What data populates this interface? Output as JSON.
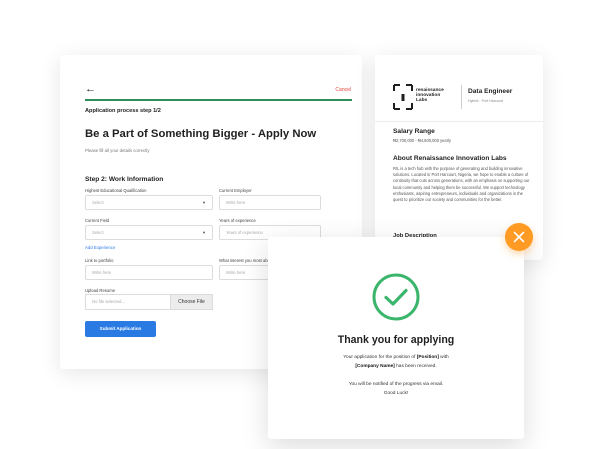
{
  "form": {
    "back_arrow": "←",
    "cancel": "Cancel",
    "step_label": "Application process step 1/2",
    "progress": 1.0,
    "title": "Be a Part of Something Bigger - Apply Now",
    "subtitle": "Please fill all your details correctly",
    "section": "Step 2: Work Information",
    "fields": {
      "qualification": {
        "label": "Highest Educational Qualification",
        "placeholder": "Select"
      },
      "employer": {
        "label": "Current Employer",
        "placeholder": "Write here"
      },
      "current_field": {
        "label": "Current Field",
        "placeholder": "Select"
      },
      "experience": {
        "label": "Years of experience",
        "placeholder": "Years of experience"
      },
      "portfolio": {
        "label": "Link to portfolio",
        "placeholder": "Write here"
      },
      "interest": {
        "label": "What interest you most abo",
        "placeholder": "Write here"
      }
    },
    "add_experience": "Add Experience",
    "upload_label": "Upload Resume",
    "file_placeholder": "No file selected...",
    "choose_file": "Choose File",
    "submit": "Submit Application"
  },
  "job": {
    "logo_lines": [
      "renaissance",
      "innovation",
      "Labs"
    ],
    "title": "Data Engineer",
    "meta": "Hybrid · Port Harcourt",
    "salary_heading": "Salary Range",
    "salary_value": "₦2,700,000 - ₦4,500,000 yearly",
    "about_heading": "About Renaissance Innovation Labs",
    "about_text": "RIL is a tech hub with the purpose of generating and building innovative solutions. Located in Port Harcourt, Nigeria, we hope to enable a culture of continuity that cuts across generations, with an emphasis on supporting our local community and helping them be successful. We support technology enthusiasts, aspiring entrepreneurs, individuals and organizations in the quest to prioritize our society and communities for the better.",
    "description_heading": "Job Description"
  },
  "thanks": {
    "title": "Thank you for applying",
    "line1_a": "Your application for the position of ",
    "position": "[Position]",
    "line1_b": " with",
    "company": "[Company Name]",
    "line2": " has been received.",
    "notice": "You will be notified of the progress via email.",
    "sign_off": "Good Luck!"
  },
  "colors": {
    "accent_blue": "#2a7ae4",
    "success_green": "#3bb56b",
    "close_orange": "#ff9a22",
    "cancel_red": "#e0453b"
  }
}
